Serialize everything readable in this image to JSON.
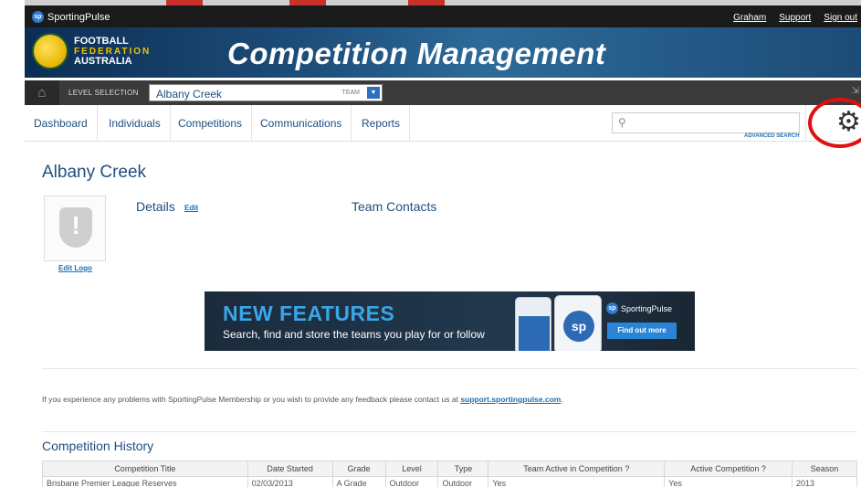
{
  "topbar": {
    "brand": "SportingPulse",
    "links": [
      "Graham",
      "Support",
      "Sign out"
    ]
  },
  "header": {
    "org_line1": "FOOTBALL",
    "org_line2": "FEDERATION",
    "org_line3": "AUSTRALIA",
    "title": "Competition Management"
  },
  "levelbar": {
    "label": "LEVEL SELECTION",
    "selected": "Albany Creek",
    "type": "TEAM"
  },
  "nav": {
    "items": [
      "Dashboard",
      "Individuals",
      "Competitions",
      "Communications",
      "Reports"
    ],
    "search_placeholder": "",
    "advanced_search": "ADVANCED SEARCH"
  },
  "team": {
    "name": "Albany Creek",
    "edit_logo": "Edit Logo",
    "details": "Details",
    "details_edit": "Edit",
    "contacts": "Team Contacts"
  },
  "ad": {
    "headline": "NEW FEATURES",
    "subline": "Search, find and store the teams you play for or follow",
    "brand": "SportingPulse",
    "cta": "Find out more",
    "phone_logo": "sp"
  },
  "feedback": {
    "text": "If you experience any problems with SportingPulse Membership or you wish to provide any feedback please contact us at ",
    "link": "support.sportingpulse.com",
    "suffix": "."
  },
  "history": {
    "title": "Competition History",
    "columns": [
      "Competition Title",
      "Date Started",
      "Grade",
      "Level",
      "Type",
      "Team Active in Competition ?",
      "Active Competition ?",
      "Season"
    ],
    "rows": [
      [
        "Brisbane Premier League Reserves",
        "02/03/2013",
        "A Grade",
        "Outdoor",
        "Outdoor",
        "Yes",
        "Yes",
        "2013"
      ]
    ]
  }
}
